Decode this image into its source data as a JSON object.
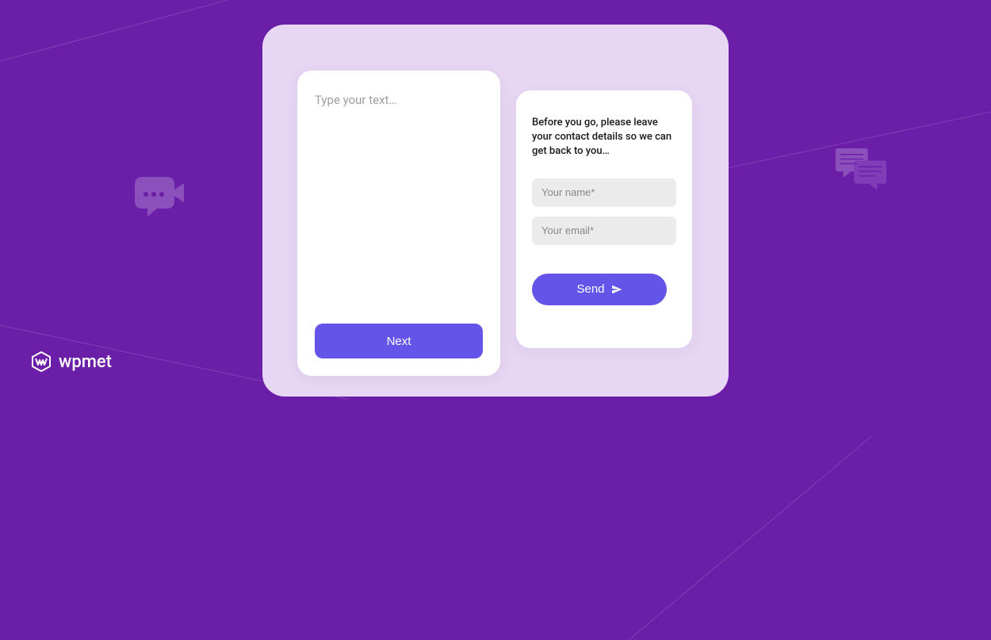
{
  "logo": {
    "text": "wpmet"
  },
  "leftCard": {
    "placeholder": "Type your text…",
    "buttonLabel": "Next"
  },
  "rightCard": {
    "message": "Before you go, please leave your contact details so we can get back to you…",
    "nameInput": {
      "placeholder": "Your name*"
    },
    "emailInput": {
      "placeholder": "Your email*"
    },
    "buttonLabel": "Send"
  },
  "icons": {
    "videoChat": "video-chat-speech-bubble",
    "chatBubbles": "double-chat-bubbles",
    "send": "paper-plane"
  }
}
